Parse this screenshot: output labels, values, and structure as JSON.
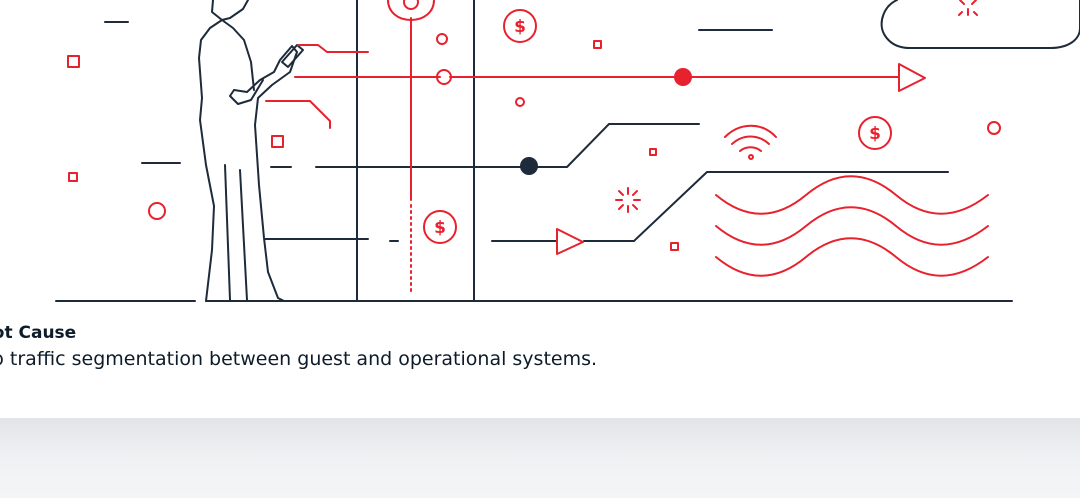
{
  "caption": {
    "title": "Root Cause",
    "text": "No traffic segmentation between guest and operational systems."
  },
  "illustration": {
    "dollar_symbol": "$",
    "icons": [
      "person-silhouette-icon",
      "location-pin-icon",
      "cloud-icon",
      "wifi-icon",
      "sparkle-icon",
      "play-arrow-icon",
      "wave-icon",
      "dollar-coin-icon"
    ]
  },
  "colors": {
    "accent": "#e8212e",
    "line": "#1d2b3a",
    "band": "#eceef1"
  }
}
